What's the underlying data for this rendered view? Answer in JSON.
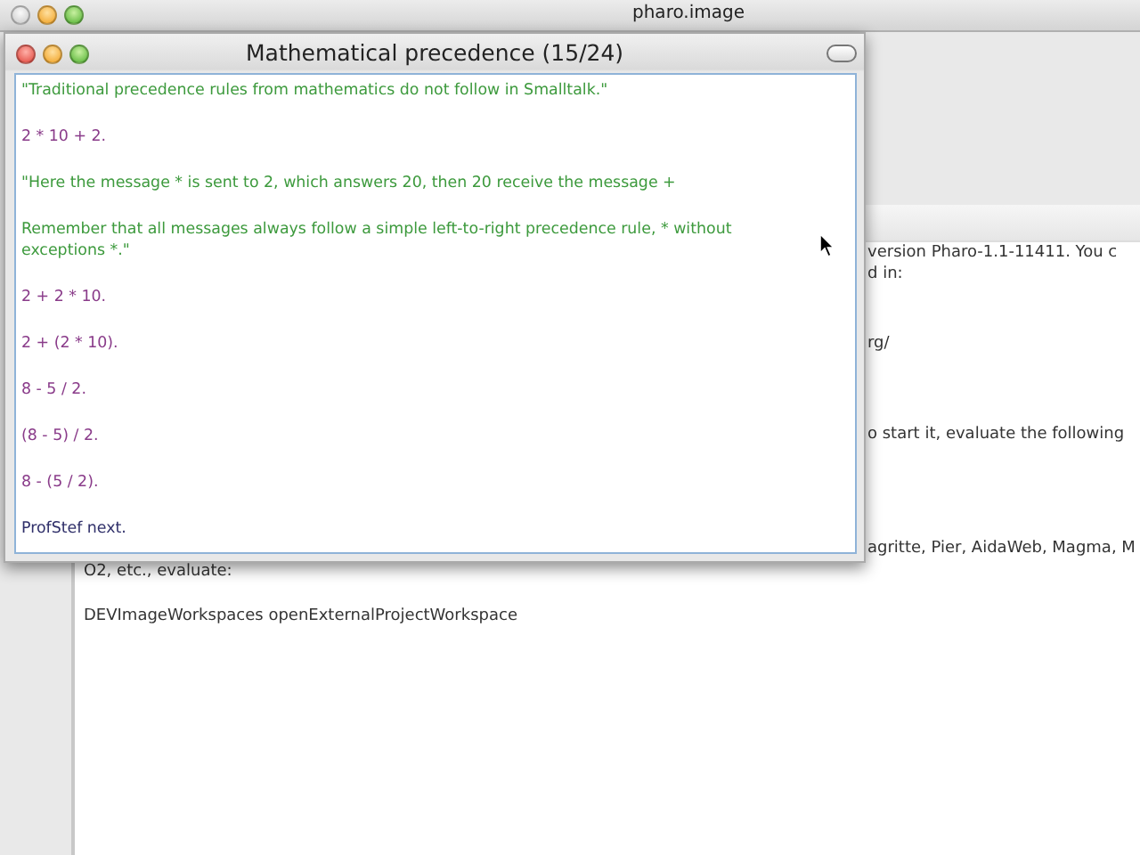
{
  "desktop_window": {
    "title": "pharo.image"
  },
  "background_workspace": {
    "lines": [
      {
        "text": "version Pharo-1.1-11411. You c",
        "kind": "clipped"
      },
      {
        "text": "d in:",
        "kind": "clipped"
      },
      {
        "text": "rg/",
        "kind": "clipped"
      },
      {
        "text": "o start it, evaluate the following",
        "kind": "clipped"
      },
      {
        "text": "agritte, Pier, AidaWeb, Magma, M",
        "kind": "clipped"
      },
      {
        "text": "O2, etc., evaluate:",
        "kind": "full"
      },
      {
        "text": "DEVImageWorkspaces openExternalProjectWorkspace",
        "kind": "full"
      }
    ]
  },
  "tutorial_window": {
    "title": "Mathematical precedence (15/24)",
    "lines": [
      {
        "kind": "comment",
        "text": "\"Traditional precedence rules from mathematics do not follow in Smalltalk.\""
      },
      {
        "kind": "code",
        "text": "2 * 10 + 2."
      },
      {
        "kind": "comment",
        "text": "\"Here the message * is sent to 2, which answers 20, then 20 receive the message +"
      },
      {
        "kind": "comment",
        "text": "Remember that all messages always follow a simple left-to-right precedence rule, * without exceptions *.\""
      },
      {
        "kind": "code",
        "text": "2 + 2 * 10."
      },
      {
        "kind": "code",
        "text": "2 + (2 * 10)."
      },
      {
        "kind": "code",
        "text": "8 - 5 / 2."
      },
      {
        "kind": "code",
        "text": "(8 - 5) / 2."
      },
      {
        "kind": "code",
        "text": "8 - (5 / 2)."
      },
      {
        "kind": "message",
        "text": "ProfStef next."
      }
    ]
  }
}
